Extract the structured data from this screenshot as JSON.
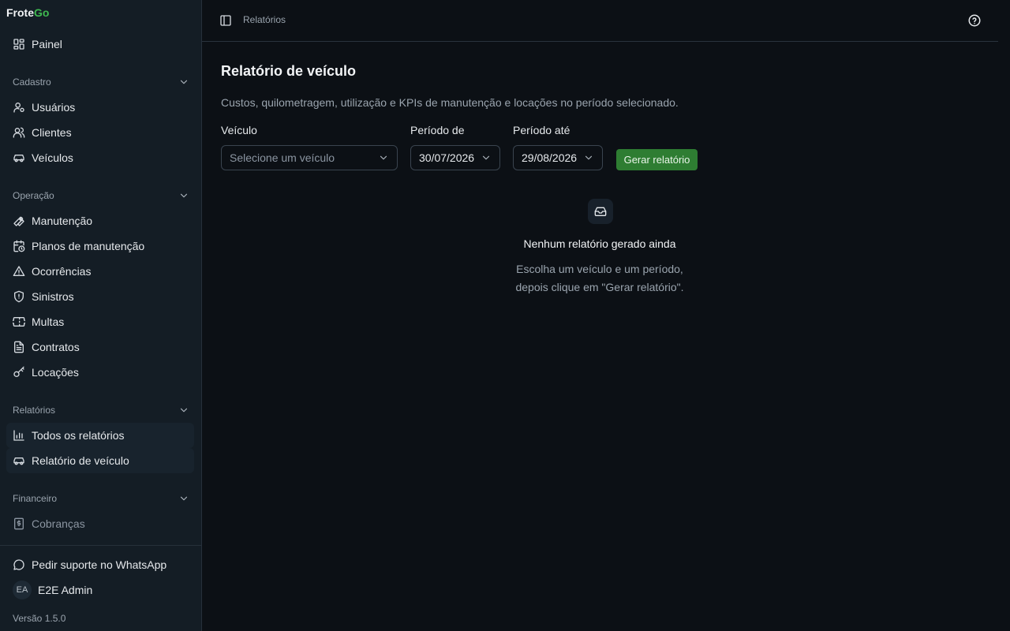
{
  "brand": {
    "name_part1": "Frote",
    "name_part2": "Go"
  },
  "sidebar": {
    "top_item": {
      "label": "Painel",
      "icon": "dashboard-icon"
    },
    "sections": [
      {
        "label": "Cadastro",
        "items": [
          {
            "label": "Usuários",
            "icon": "user-icon"
          },
          {
            "label": "Clientes",
            "icon": "users-icon"
          },
          {
            "label": "Veículos",
            "icon": "car-icon"
          }
        ]
      },
      {
        "label": "Operação",
        "items": [
          {
            "label": "Manutenção",
            "icon": "wrench-icon"
          },
          {
            "label": "Planos de manutenção",
            "icon": "calendar-clock-icon"
          },
          {
            "label": "Ocorrências",
            "icon": "alert-triangle-icon"
          },
          {
            "label": "Sinistros",
            "icon": "shield-icon"
          },
          {
            "label": "Multas",
            "icon": "ticket-icon"
          },
          {
            "label": "Contratos",
            "icon": "file-text-icon"
          },
          {
            "label": "Locações",
            "icon": "key-icon"
          }
        ]
      },
      {
        "label": "Relatórios",
        "items": [
          {
            "label": "Todos os relatórios",
            "icon": "bar-chart-icon"
          },
          {
            "label": "Relatório de veículo",
            "icon": "car-icon"
          }
        ]
      },
      {
        "label": "Financeiro",
        "items": [
          {
            "label": "Cobranças",
            "icon": "receipt-icon"
          }
        ]
      }
    ],
    "support": {
      "label": "Pedir suporte no WhatsApp",
      "icon": "chat-icon"
    },
    "user": {
      "initials": "EA",
      "name": "E2E Admin"
    },
    "version": "Versão 1.5.0"
  },
  "topbar": {
    "breadcrumb": "Relatórios"
  },
  "main": {
    "title": "Relatório de veículo",
    "subtitle": "Custos, quilometragem, utilização e KPIs de manutenção e locações no período selecionado.",
    "vehicle": {
      "label": "Veículo",
      "placeholder": "Selecione um veículo"
    },
    "period_from": {
      "label": "Período de",
      "value": "30/07/2026"
    },
    "period_to": {
      "label": "Período até",
      "value": "29/08/2026"
    },
    "generate_button": "Gerar relatório",
    "empty_state": {
      "title": "Nenhum relatório gerado ainda",
      "line1": "Escolha um veículo e um período,",
      "line2": "depois clique em \"Gerar relatório\"."
    }
  },
  "colors": {
    "accent": "#3fb950",
    "button": "#2e7d32",
    "background": "#0c1015",
    "sidebar": "#141d25"
  }
}
